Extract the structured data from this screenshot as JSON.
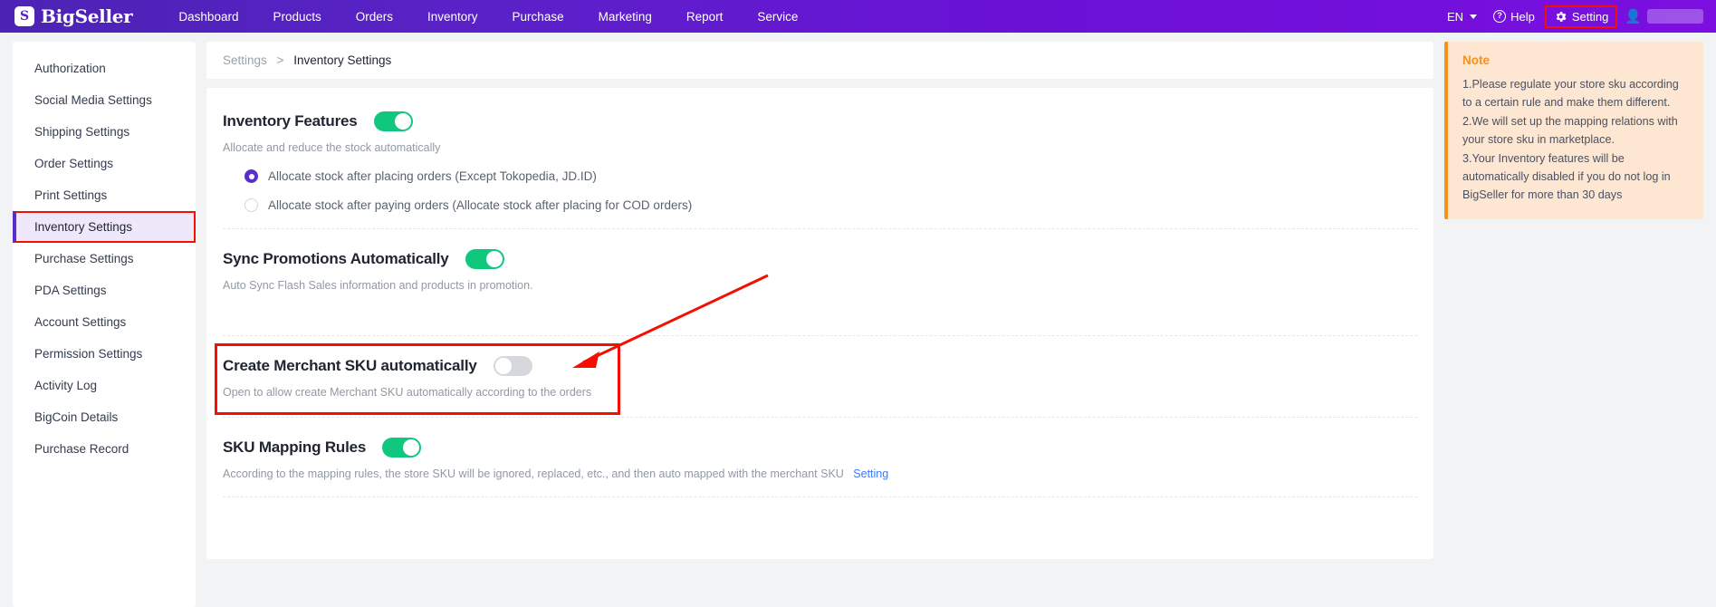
{
  "header": {
    "brand": "BigSeller",
    "brand_mark": "S",
    "nav": [
      {
        "label": "Dashboard"
      },
      {
        "label": "Products"
      },
      {
        "label": "Orders"
      },
      {
        "label": "Inventory"
      },
      {
        "label": "Purchase"
      },
      {
        "label": "Marketing"
      },
      {
        "label": "Report"
      },
      {
        "label": "Service"
      }
    ],
    "language": "EN",
    "help": "Help",
    "setting": "Setting",
    "icons": {
      "help": "question-circle-icon",
      "setting": "gear-icon",
      "user": "user-avatar-icon",
      "language_caret": "chevron-down-icon"
    }
  },
  "sidebar": {
    "items": [
      {
        "label": "Authorization",
        "active": false
      },
      {
        "label": "Social Media Settings",
        "active": false
      },
      {
        "label": "Shipping Settings",
        "active": false
      },
      {
        "label": "Order Settings",
        "active": false
      },
      {
        "label": "Print Settings",
        "active": false
      },
      {
        "label": "Inventory Settings",
        "active": true
      },
      {
        "label": "Purchase Settings",
        "active": false
      },
      {
        "label": "PDA Settings",
        "active": false
      },
      {
        "label": "Account Settings",
        "active": false
      },
      {
        "label": "Permission Settings",
        "active": false
      },
      {
        "label": "Activity Log",
        "active": false
      },
      {
        "label": "BigCoin Details",
        "active": false
      },
      {
        "label": "Purchase Record",
        "active": false
      }
    ]
  },
  "breadcrumb": {
    "root": "Settings",
    "separator": ">",
    "current": "Inventory Settings"
  },
  "sections": {
    "inventory_features": {
      "title": "Inventory Features",
      "toggle_state": "on",
      "subtitle": "Allocate and reduce the stock automatically",
      "options": [
        {
          "label": "Allocate stock after placing orders (Except Tokopedia, JD.ID)",
          "selected": true
        },
        {
          "label": "Allocate stock after paying orders (Allocate stock after placing for COD orders)",
          "selected": false
        }
      ]
    },
    "sync_promotions": {
      "title": "Sync Promotions Automatically",
      "toggle_state": "on",
      "subtitle": "Auto Sync Flash Sales information and products in promotion."
    },
    "create_merchant_sku": {
      "title": "Create Merchant SKU automatically",
      "toggle_state": "off",
      "subtitle": "Open to allow create Merchant SKU automatically according to the orders"
    },
    "sku_mapping_rules": {
      "title": "SKU Mapping Rules",
      "toggle_state": "on",
      "subtitle": "According to the mapping rules, the store SKU will be ignored, replaced, etc., and then auto mapped with the merchant SKU",
      "link_label": "Setting"
    }
  },
  "note": {
    "title": "Note",
    "lines": [
      "1.Please regulate your store sku according to a certain rule and make them different.",
      "2.We will set up the mapping relations with your store sku in marketplace.",
      "3.Your Inventory features will be automatically disabled if you do not log in BigSeller for more than 30 days"
    ]
  },
  "annotations": {
    "accent_purple": "#5b2ecb",
    "toggle_on_green": "#10c77e",
    "highlight_red": "#f40f02",
    "note_orange": "#f5911e"
  }
}
